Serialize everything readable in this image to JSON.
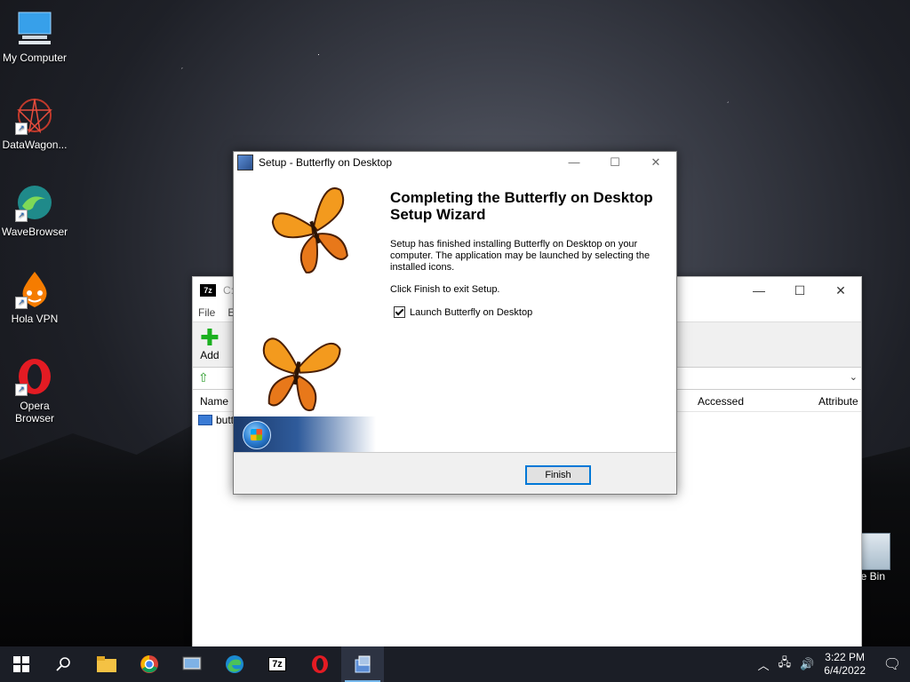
{
  "desktop": {
    "icons": [
      {
        "label": "My Computer"
      },
      {
        "label": "DataWagon..."
      },
      {
        "label": "WaveBrowser"
      },
      {
        "label": "Hola VPN"
      },
      {
        "label": "Opera Browser"
      }
    ],
    "recycle_bin": {
      "label": "cle Bin"
    }
  },
  "zip_window": {
    "title": "C:\\",
    "menu": [
      "File",
      "E"
    ],
    "toolbar": {
      "add_label": "Add"
    },
    "columns": {
      "name": "Name",
      "accessed": "Accessed",
      "attributes": "Attribute"
    },
    "row_name": "butt"
  },
  "setup_dialog": {
    "title": "Setup - Butterfly on Desktop",
    "heading": "Completing the Butterfly on Desktop Setup Wizard",
    "body": "Setup has finished installing Butterfly on Desktop on your computer. The application may be launched by selecting the installed icons.",
    "exit_text": "Click Finish to exit Setup.",
    "checkbox_label": "Launch Butterfly on Desktop",
    "checkbox_checked": true,
    "finish_label": "Finish"
  },
  "taskbar": {
    "time": "3:22 PM",
    "date": "6/4/2022"
  }
}
